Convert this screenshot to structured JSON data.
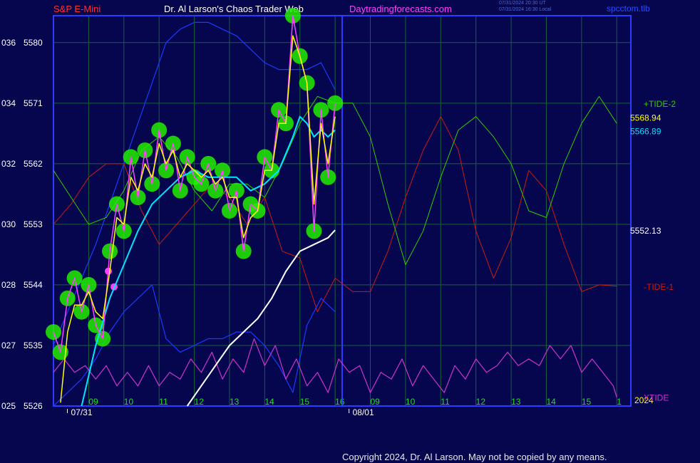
{
  "header": {
    "symbol": "S&P E-Mini",
    "title": "Dr. Al Larson's Chaos Trader Web",
    "site": "Daytradingforecasts.com",
    "utc_time": "07/31/2024 20:30 UT",
    "local_time": "07/31/2024 16:30 Local",
    "brand": "spcctom.tlb"
  },
  "copyright": "Copyright 2024, Dr. Al Larson. May not be copied by any means.",
  "colors": {
    "background": "#06064e",
    "grid": "#16603a",
    "frame": "#2a3cff",
    "price": "#ff40ff",
    "price_bubbles": "#22ee00",
    "fast_ma": "#ffff00",
    "slow_ma": "#00e5ff",
    "long_ma": "#ffffff",
    "tide_plus2": "#33cc00",
    "tide_minus1": "#cc1a10",
    "xtide": "#cc33cc",
    "band": "#1a3aff"
  },
  "chart_data": {
    "type": "line",
    "y_axis": {
      "range": [
        5526,
        5584
      ],
      "ticks": [
        {
          "left": "025",
          "right": "5526",
          "value": 5526
        },
        {
          "left": "027",
          "right": "5535",
          "value": 5535
        },
        {
          "left": "028",
          "right": "5544",
          "value": 5544
        },
        {
          "left": "030",
          "right": "5553",
          "value": 5553
        },
        {
          "left": "032",
          "right": "5562",
          "value": 5562
        },
        {
          "left": "034",
          "right": "5571",
          "value": 5571
        },
        {
          "left": "036",
          "right": "5580",
          "value": 5580
        }
      ]
    },
    "x_axis": {
      "range": [
        8.0,
        16.2
      ],
      "hour_ticks": [
        {
          "label": "09",
          "x": 9
        },
        {
          "label": "10",
          "x": 10
        },
        {
          "label": "11",
          "x": 11
        },
        {
          "label": "12",
          "x": 12
        },
        {
          "label": "13",
          "x": 13
        },
        {
          "label": "14",
          "x": 14
        },
        {
          "label": "15",
          "x": 15
        },
        {
          "label": "16",
          "x": 16
        },
        {
          "label": "09",
          "x": 17
        },
        {
          "label": "10",
          "x": 18
        },
        {
          "label": "11",
          "x": 19
        },
        {
          "label": "12",
          "x": 20
        },
        {
          "label": "13",
          "x": 21
        },
        {
          "label": "14",
          "x": 22
        },
        {
          "label": "15",
          "x": 23
        },
        {
          "label": "1",
          "x": 24
        }
      ],
      "date_labels": [
        {
          "label": "07/31",
          "x": 8.8
        },
        {
          "label": "08/01",
          "x": 16.8
        }
      ],
      "year_label": "2024"
    },
    "grid": true,
    "value_labels": [
      {
        "text": "5568.94",
        "y": 5568.94,
        "color": "#ffff00"
      },
      {
        "text": "5566.89",
        "y": 5566.89,
        "color": "#00e5ff"
      },
      {
        "text": "5552.13",
        "y": 5552.13,
        "color": "#ffffff"
      }
    ],
    "series_labels": [
      {
        "text": "+TIDE-2",
        "y": 5571,
        "color": "#33cc00"
      },
      {
        "text": "-TIDE-1",
        "y": 5543.8,
        "color": "#cc1a10"
      },
      {
        "text": "XTIDE",
        "y": 5527.3,
        "color": "#cc33cc"
      }
    ],
    "series": [
      {
        "key": "price",
        "x": [
          8.0,
          8.2,
          8.4,
          8.6,
          8.8,
          9.0,
          9.2,
          9.4,
          9.6,
          9.8,
          10.0,
          10.2,
          10.4,
          10.6,
          10.8,
          11.0,
          11.2,
          11.4,
          11.6,
          11.8,
          12.0,
          12.2,
          12.4,
          12.6,
          12.8,
          13.0,
          13.2,
          13.4,
          13.6,
          13.8,
          14.0,
          14.2,
          14.4,
          14.6,
          14.8,
          15.0,
          15.2,
          15.4,
          15.6,
          15.8,
          16.0
        ],
        "y": [
          5537,
          5534,
          5542,
          5545,
          5540,
          5544,
          5538,
          5536,
          5549,
          5556,
          5552,
          5563,
          5557,
          5564,
          5559,
          5567,
          5561,
          5565,
          5558,
          5563,
          5560,
          5559,
          5562,
          5558,
          5561,
          5555,
          5558,
          5549,
          5556,
          5555,
          5563,
          5561,
          5570,
          5568,
          5584,
          5578,
          5574,
          5552,
          5570,
          5560,
          5571
        ]
      },
      {
        "key": "fast_ma",
        "x": [
          8.2,
          8.4,
          8.6,
          8.8,
          9.0,
          9.2,
          9.4,
          9.6,
          9.8,
          10.0,
          10.2,
          10.4,
          10.6,
          10.8,
          11.0,
          11.2,
          11.4,
          11.6,
          11.8,
          12.0,
          12.2,
          12.4,
          12.6,
          12.8,
          13.0,
          13.2,
          13.4,
          13.6,
          13.8,
          14.0,
          14.2,
          14.4,
          14.6,
          14.8,
          15.0,
          15.2,
          15.4,
          15.6,
          15.8,
          16.0
        ],
        "y": [
          5526.5,
          5537,
          5541,
          5541,
          5543,
          5540,
          5539,
          5546,
          5554,
          5553,
          5560,
          5558,
          5562,
          5560,
          5565,
          5562,
          5564,
          5560,
          5562,
          5561,
          5560,
          5561,
          5559,
          5560,
          5557,
          5557,
          5551,
          5554,
          5555,
          5561,
          5561,
          5568,
          5568,
          5581,
          5578,
          5574,
          5556,
          5568,
          5562,
          5569
        ]
      },
      {
        "key": "slow_ma",
        "x": [
          8.8,
          9.2,
          9.6,
          10.0,
          10.4,
          10.8,
          11.2,
          11.6,
          12.0,
          12.4,
          12.8,
          13.2,
          13.6,
          14.0,
          14.4,
          14.8,
          15.0,
          15.2,
          15.4,
          15.6,
          15.8,
          16.0
        ],
        "y": [
          5526,
          5535,
          5542,
          5547,
          5552,
          5556,
          5558,
          5560,
          5561,
          5560,
          5560,
          5560,
          5558,
          5559,
          5561,
          5566,
          5569,
          5568,
          5566,
          5567,
          5566,
          5567
        ]
      },
      {
        "key": "long_ma",
        "x": [
          11.8,
          12.2,
          12.6,
          13.0,
          13.4,
          13.8,
          14.2,
          14.6,
          15.0,
          15.4,
          15.8,
          16.0
        ],
        "y": [
          5526,
          5529,
          5532,
          5535,
          5537,
          5539,
          5542,
          5546,
          5549,
          5550,
          5551,
          5552.13
        ]
      },
      {
        "key": "band_upper",
        "x": [
          8.0,
          8.4,
          8.8,
          9.2,
          9.6,
          10.0,
          10.4,
          10.8,
          11.2,
          11.6,
          12.0,
          12.4,
          12.8,
          13.2,
          13.6,
          14.0,
          14.4,
          14.8,
          15.2,
          15.6,
          16.0
        ],
        "y": [
          5535,
          5540,
          5545,
          5550,
          5556,
          5562,
          5568,
          5574,
          5580,
          5582,
          5583,
          5583,
          5582,
          5581,
          5579,
          5577,
          5576,
          5576,
          5576,
          5577,
          5573
        ]
      },
      {
        "key": "band_lower",
        "x": [
          8.0,
          8.4,
          8.8,
          9.2,
          9.6,
          10.0,
          10.4,
          10.8,
          11.2,
          11.6,
          12.0,
          12.4,
          12.8,
          13.2,
          13.6,
          14.0,
          14.4,
          14.8,
          15.2,
          15.6,
          16.0
        ],
        "y": [
          5526,
          5528,
          5530,
          5533,
          5537,
          5540,
          5542,
          5544,
          5536,
          5534,
          5535,
          5536,
          5536,
          5537,
          5537,
          5535,
          5532,
          5528,
          5538,
          5542,
          5540
        ]
      },
      {
        "name": "+TIDE-2",
        "key": "tide_plus2",
        "x": [
          8.0,
          8.5,
          9.0,
          9.5,
          10.0,
          10.5,
          11.0,
          11.5,
          12.0,
          12.5,
          13.0,
          13.5,
          14.0,
          14.5,
          15.0,
          15.5,
          16.0,
          16.5,
          17.0,
          17.5,
          18.0,
          18.5,
          19.0,
          19.5,
          20.0,
          20.5,
          21.0,
          21.5,
          22.0,
          22.5,
          23.0,
          23.5,
          24.0
        ],
        "y": [
          5561,
          5557,
          5553,
          5554,
          5558,
          5564,
          5566,
          5563,
          5558,
          5555,
          5559,
          5559,
          5557,
          5562,
          5568,
          5572,
          5571,
          5571,
          5566,
          5556,
          5547,
          5552,
          5560,
          5567,
          5569,
          5566,
          5562,
          5555,
          5554,
          5562,
          5568,
          5572,
          5568
        ]
      },
      {
        "name": "-TIDE-1",
        "key": "tide_minus1",
        "x": [
          8.0,
          8.5,
          9.0,
          9.5,
          10.0,
          10.5,
          11.0,
          11.5,
          12.0,
          12.5,
          13.0,
          13.5,
          14.0,
          14.5,
          15.0,
          15.5,
          16.0,
          16.5,
          17.0,
          17.5,
          18.0,
          18.5,
          19.0,
          19.5,
          20.0,
          20.5,
          21.0,
          21.5,
          22.0,
          22.5,
          23.0,
          23.5,
          24.0
        ],
        "y": [
          5553,
          5556,
          5560,
          5562,
          5562,
          5555,
          5550,
          5553,
          5556,
          5559,
          5557,
          5553,
          5557,
          5549,
          5548,
          5540,
          5545,
          5543,
          5543,
          5549,
          5557,
          5564,
          5569,
          5564,
          5552,
          5545,
          5551,
          5561,
          5558,
          5550,
          5543,
          5544,
          5543.8
        ]
      },
      {
        "name": "XTIDE",
        "key": "xtide",
        "x": [
          8.0,
          8.3,
          8.6,
          8.9,
          9.2,
          9.5,
          9.8,
          10.1,
          10.4,
          10.7,
          11.0,
          11.3,
          11.6,
          11.9,
          12.2,
          12.5,
          12.8,
          13.1,
          13.4,
          13.7,
          14.0,
          14.3,
          14.6,
          14.9,
          15.2,
          15.5,
          15.8,
          16.1,
          16.4,
          16.7,
          17.0,
          17.3,
          17.6,
          17.9,
          18.2,
          18.5,
          18.8,
          19.1,
          19.4,
          19.7,
          20.0,
          20.3,
          20.6,
          20.9,
          21.2,
          21.5,
          21.8,
          22.1,
          22.4,
          22.7,
          23.0,
          23.3,
          23.6,
          23.9,
          24.0
        ],
        "y": [
          5531,
          5533,
          5531,
          5532,
          5530,
          5532,
          5529,
          5531,
          5529,
          5532,
          5529,
          5531,
          5530,
          5533,
          5531,
          5534,
          5530,
          5533,
          5531,
          5536,
          5532,
          5535,
          5530,
          5533,
          5529,
          5531,
          5528,
          5533,
          5531,
          5532,
          5528,
          5531,
          5530,
          5533,
          5529,
          5532,
          5530,
          5528,
          5532,
          5530,
          5533,
          5531,
          5532,
          5534,
          5532,
          5533,
          5532,
          5535,
          5533,
          5535,
          5531,
          5533,
          5531,
          5529,
          5527.3
        ]
      }
    ]
  }
}
